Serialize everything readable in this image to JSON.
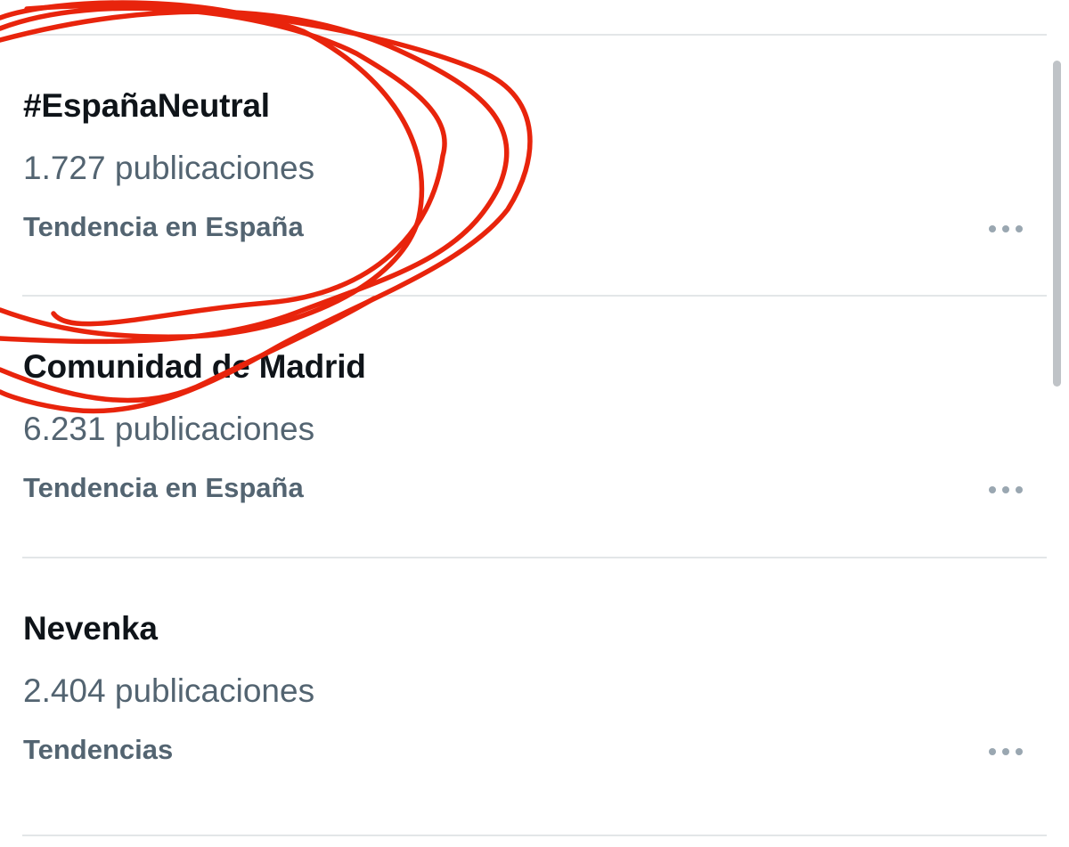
{
  "trends": [
    {
      "title": "#EspañaNeutral",
      "count": "1.727 publicaciones",
      "context": "Tendencia en España",
      "more_icon": "more-horizontal-icon"
    },
    {
      "title": "Comunidad de Madrid",
      "count": "6.231 publicaciones",
      "context": "Tendencia en España",
      "more_icon": "more-horizontal-icon"
    },
    {
      "title": "Nevenka",
      "count": "2.404 publicaciones",
      "context": "Tendencias",
      "more_icon": "more-horizontal-icon"
    }
  ],
  "colors": {
    "title": "#0f1419",
    "secondary": "#536471",
    "divider": "#e3e6e8",
    "annotation": "#e8240c"
  }
}
